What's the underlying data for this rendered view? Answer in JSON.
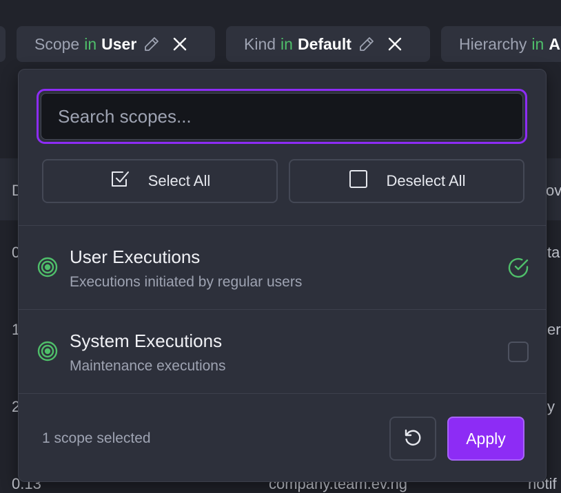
{
  "filters": [
    {
      "field": "Scope",
      "op": "in",
      "value": "User"
    },
    {
      "field": "Kind",
      "op": "in",
      "value": "Default"
    },
    {
      "field": "Hierarchy",
      "op": "in",
      "value": "A"
    }
  ],
  "background_table": {
    "header_partial": "D",
    "header_partial_right": "ov",
    "rows_left": [
      "0",
      "1",
      "2",
      "0.13"
    ],
    "rows_right": [
      "ta",
      "er",
      "y",
      "notif"
    ],
    "row4_middle": "company.team.ev.ng"
  },
  "dropdown": {
    "search": {
      "placeholder": "Search scopes...",
      "value": ""
    },
    "select_all_label": "Select All",
    "deselect_all_label": "Deselect All",
    "options": [
      {
        "title": "User Executions",
        "description": "Executions initiated by regular users",
        "selected": true
      },
      {
        "title": "System Executions",
        "description": "Maintenance executions",
        "selected": false
      }
    ],
    "footer": {
      "summary": "1 scope selected",
      "apply_label": "Apply"
    }
  },
  "colors": {
    "accent": "#8d2cf5",
    "green": "#4fbf6a",
    "background": "#21232b",
    "panel": "#2d303b"
  },
  "icons": [
    "pencil-icon",
    "close-icon",
    "checkbox-checked-icon",
    "checkbox-empty-icon",
    "target-icon",
    "check-circle-icon",
    "reset-icon"
  ]
}
